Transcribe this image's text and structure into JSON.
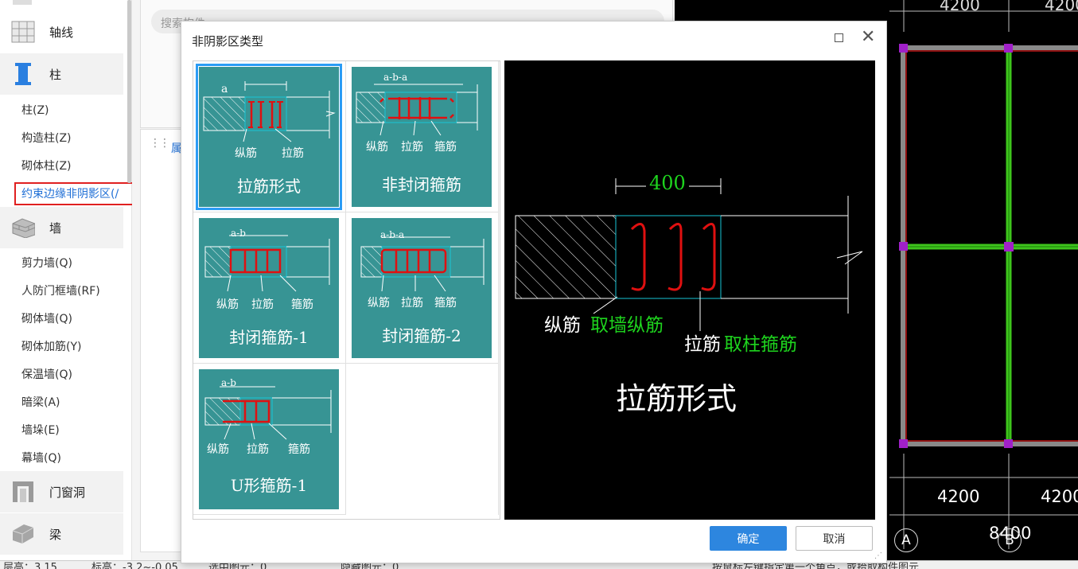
{
  "sidebar": {
    "categories": [
      {
        "label": "轴线",
        "icon": "grid-icon"
      },
      {
        "label": "柱",
        "icon": "column-icon"
      },
      {
        "label": "墙",
        "icon": "brick-wall-icon"
      },
      {
        "label": "门窗洞",
        "icon": "door-window-icon"
      },
      {
        "label": "梁",
        "icon": "beam-icon"
      }
    ],
    "column_items": [
      "柱(Z)",
      "构造柱(Z)",
      "砌体柱(Z)",
      "约束边缘非阴影区(/"
    ],
    "wall_items": [
      "剪力墙(Q)",
      "人防门框墙(RF)",
      "砌体墙(Q)",
      "砌体加筋(Y)",
      "保温墙(Q)",
      "暗梁(A)",
      "墙垛(E)",
      "幕墙(Q)"
    ],
    "active_item_color": "#1f6fd6",
    "highlight_color": "#e02020"
  },
  "middle": {
    "search_placeholder": "搜索构件",
    "tab_label": "属"
  },
  "cad": {
    "top_dims": [
      "4200",
      "4200"
    ],
    "bottom_dims": [
      "4200",
      "4200"
    ],
    "total_dim": "8400",
    "axis_labels": [
      "A",
      "B"
    ],
    "beam_color": "#3ec51c",
    "node_color": "#a020c8"
  },
  "status_bar": {
    "floor_height": "层高：3.15",
    "elevation": "标高：-3.2~-0.05",
    "selected_count": "选中图元：0",
    "hidden_count": "隐藏图元：0",
    "hint": "按鼠标左键指定第一个角点，或拾取构件图元"
  },
  "dialog": {
    "title": "非阴影区类型",
    "ok_label": "确定",
    "cancel_label": "取消",
    "accent": "#2d86df",
    "thumb_bg": "#379494",
    "options": [
      {
        "caption": "拉筋形式",
        "labels": [
          "纵筋",
          "拉筋"
        ],
        "dims": "a",
        "selected": true
      },
      {
        "caption": "非封闭箍筋",
        "labels": [
          "纵筋",
          "拉筋",
          "箍筋"
        ],
        "dims": "a-b-a"
      },
      {
        "caption": "封闭箍筋-1",
        "labels": [
          "纵筋",
          "拉筋",
          "箍筋"
        ],
        "dims": "a-b"
      },
      {
        "caption": "封闭箍筋-2",
        "labels": [
          "纵筋",
          "拉筋",
          "箍筋"
        ],
        "dims": "a-b-a"
      },
      {
        "caption": "U形箍筋-1",
        "labels": [
          "纵筋",
          "拉筋",
          "箍筋"
        ],
        "dims": "a-b"
      }
    ],
    "preview": {
      "dim_value": "400",
      "label_long_bar": "纵筋",
      "label_long_bar_value": "取墙纵筋",
      "label_tie": "拉筋",
      "label_tie_value": "取柱箍筋",
      "caption": "拉筋形式",
      "green": "#1ed41e",
      "red": "#e01010",
      "cyan": "#19c6d6"
    }
  }
}
